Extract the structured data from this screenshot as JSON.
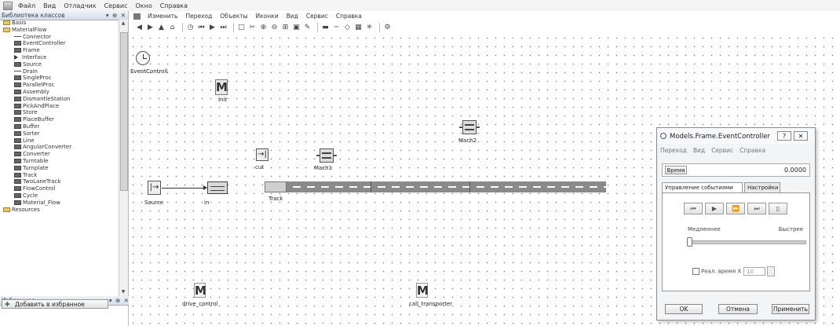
{
  "app_menu": [
    "Файл",
    "Вид",
    "Отладчик",
    "Сервис",
    "Окно",
    "Справка"
  ],
  "class_library": {
    "title": "Библиотека классов",
    "controls": "▾ ⊕ ✕",
    "items": [
      {
        "label": "Basis",
        "icon": "folder-icon"
      },
      {
        "label": "MaterialFlow",
        "icon": "folder-icon"
      },
      {
        "label": "Connector",
        "icon": "connector-icon"
      },
      {
        "label": "EventController",
        "icon": "clock-icon"
      },
      {
        "label": "Frame",
        "icon": "frame-icon"
      },
      {
        "label": "Interface",
        "icon": "interface-icon"
      },
      {
        "label": "Source",
        "icon": "source-icon"
      },
      {
        "label": "Drain",
        "icon": "drain-icon"
      },
      {
        "label": "SingleProc",
        "icon": "singleproc-icon"
      },
      {
        "label": "ParallelProc",
        "icon": "parallelproc-icon"
      },
      {
        "label": "Assembly",
        "icon": "assembly-icon"
      },
      {
        "label": "DismantleStation",
        "icon": "dismantle-icon"
      },
      {
        "label": "PickAndPlace",
        "icon": "pickandplace-icon"
      },
      {
        "label": "Store",
        "icon": "store-icon"
      },
      {
        "label": "PlaceBuffer",
        "icon": "placebuffer-icon"
      },
      {
        "label": "Buffer",
        "icon": "buffer-icon"
      },
      {
        "label": "Sorter",
        "icon": "sorter-icon"
      },
      {
        "label": "Line",
        "icon": "line-icon"
      },
      {
        "label": "AngularConverter",
        "icon": "angularconverter-icon"
      },
      {
        "label": "Converter",
        "icon": "converter-icon"
      },
      {
        "label": "Turntable",
        "icon": "turntable-icon"
      },
      {
        "label": "Turnplate",
        "icon": "turnplate-icon"
      },
      {
        "label": "Track",
        "icon": "track-icon"
      },
      {
        "label": "TwoLaneTrack",
        "icon": "twolanetrack-icon"
      },
      {
        "label": "FlowControl",
        "icon": "flowcontrol-icon"
      },
      {
        "label": "Cycle",
        "icon": "cycle-icon"
      },
      {
        "label": "Material_Flow",
        "icon": "materialflow-icon"
      },
      {
        "label": "Resources",
        "icon": "folder-icon"
      }
    ]
  },
  "favorites": {
    "title": "Избранное",
    "controls": "▾ ⊕ ✕",
    "add_button": "Добавить в избранное"
  },
  "editor": {
    "menu": [
      "Изменить",
      "Переход",
      "Объекты",
      "Иконки",
      "Вид",
      "Сервис",
      "Справка"
    ],
    "toolbar_icons": [
      "back-icon",
      "forward-icon",
      "up-icon",
      "home-icon",
      "eventcontroller-icon",
      "reset-icon",
      "start-icon",
      "step-icon",
      "new-icon",
      "cut-icon",
      "zoom-in-icon",
      "zoom-out-icon",
      "grid-icon",
      "open-icon",
      "edit-icon",
      "layout-icon",
      "line-icon",
      "shape-icon",
      "table-icon",
      "wizard-icon",
      "settings-icon"
    ],
    "objects": {
      "event_controller": "EventControll",
      "init": "init",
      "cut": "cut",
      "mach1": "Mach1",
      "mach2": "Mach2",
      "source": "Source",
      "in": "in",
      "track": "Track",
      "drive_control": "drive_control",
      "call_transporter": "call_transporter"
    }
  },
  "event_controller_dialog": {
    "title": "Models.Frame.EventController",
    "help_btn": "?",
    "close_btn": "✕",
    "menu": [
      "Переход",
      "Вид",
      "Сервис",
      "Справка"
    ],
    "time_button": "Время",
    "time_value": "0.0000",
    "tabs": [
      "Управление событиями",
      "Настройки"
    ],
    "playback_buttons": [
      "reset-icon",
      "start-icon",
      "fast-forward-icon",
      "step-icon",
      "stop-icon"
    ],
    "slow_label": "Медленнее",
    "fast_label": "Быстрее",
    "speed": 0,
    "realtime_label": "Реал. время X",
    "realtime_value": "10",
    "ok_button": "OK",
    "cancel_button": "Отмена",
    "apply_button": "Применить"
  }
}
